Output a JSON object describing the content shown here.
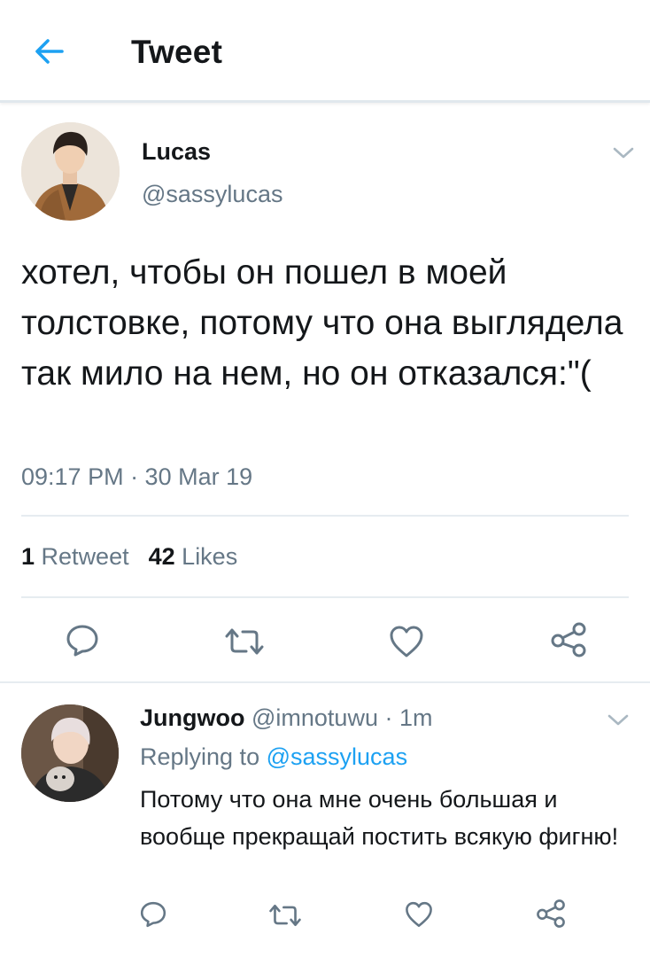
{
  "header": {
    "title": "Tweet",
    "back_icon": "arrow-left-icon",
    "accent_color": "#1da1f2"
  },
  "tweet": {
    "author_name": "Lucas",
    "author_handle": "@sassylucas",
    "text": "хотел, чтобы он пошел в моей толстовке, потому что она выглядела так мило на нем, но он отказался:\"(",
    "timestamp": "09:17 PM · 30 Mar 19",
    "retweet_count": "1",
    "retweet_label": "Retweet",
    "like_count": "42",
    "like_label": "Likes",
    "menu_icon": "chevron-down-icon",
    "actions": [
      "reply-icon",
      "retweet-icon",
      "like-icon",
      "share-icon"
    ]
  },
  "reply": {
    "author_name": "Jungwoo",
    "author_handle": "@imnotuwu",
    "separator": "·",
    "time": "1m",
    "replying_prefix": "Replying to",
    "replying_to": "@sassylucas",
    "text": "Потому что она мне очень большая и вообще прекращай постить всякую фигню!",
    "menu_icon": "chevron-down-icon",
    "actions": [
      "reply-icon",
      "retweet-icon",
      "like-icon",
      "share-icon"
    ]
  },
  "colors": {
    "text_primary": "#14171a",
    "text_secondary": "#657786",
    "link": "#1da1f2",
    "divider": "#e6ecf0"
  }
}
